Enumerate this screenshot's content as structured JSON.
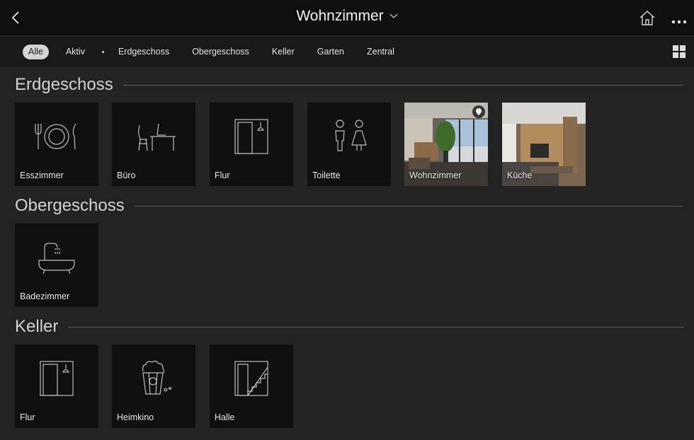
{
  "header": {
    "title": "Wohnzimmer",
    "icons": [
      "back-chevron-icon",
      "dropdown-chevron-icon",
      "home-icon",
      "more-dots-icon"
    ]
  },
  "filters": {
    "items": [
      "Alle",
      "Aktiv",
      "Erdgeschoss",
      "Obergeschoss",
      "Keller",
      "Garten",
      "Zentral"
    ],
    "active": "Alle"
  },
  "sections": {
    "erdgeschoss": {
      "title": "Erdgeschoss",
      "rooms": [
        {
          "label": "Esszimmer",
          "icon": "dining-icon"
        },
        {
          "label": "Büro",
          "icon": "office-desk-icon"
        },
        {
          "label": "Flur",
          "icon": "hallway-door-icon"
        },
        {
          "label": "Toilette",
          "icon": "toilet-icon"
        },
        {
          "label": "Wohnzimmer",
          "icon": "location-pin-icon"
        },
        {
          "label": "Küche"
        }
      ]
    },
    "obergeschoss": {
      "title": "Obergeschoss",
      "rooms": [
        {
          "label": "Badezimmer",
          "icon": "bathtub-icon"
        }
      ]
    },
    "keller": {
      "title": "Keller",
      "rooms": [
        {
          "label": "Flur",
          "icon": "hallway-door-icon"
        },
        {
          "label": "Heimkino",
          "icon": "popcorn-icon"
        },
        {
          "label": "Halle",
          "icon": "stairs-icon"
        }
      ]
    }
  },
  "colors": {
    "background": "#232323",
    "topbar": "#0f0f0f",
    "filterbar": "#191919",
    "tile": "#101010",
    "active_chip": "#d4d4d4"
  }
}
